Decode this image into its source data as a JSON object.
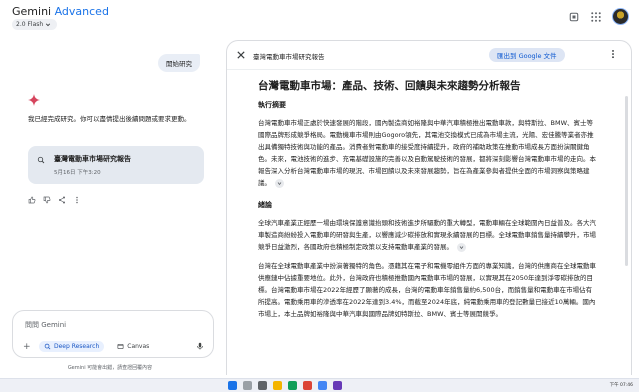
{
  "header": {
    "brand_gemini": "Gemini",
    "brand_advanced": "Advanced",
    "model": "2.0 Flash"
  },
  "chat": {
    "user_message": "開始研究",
    "reply": "我已經完成研究。你可以盡情提出後續問題或要求更動。",
    "report_card": {
      "title": "臺灣電動車市場研究報告",
      "date": "5月16日 下午3:20"
    },
    "input_placeholder": "問問 Gemini",
    "tools": {
      "deep_research": "Deep Research",
      "canvas": "Canvas"
    },
    "disclaimer": "Gemini 可能會出錯，請查證回覆內容"
  },
  "doc": {
    "header_title": "臺灣電動車市場研究報告",
    "export_label": "匯出到 Google 文件",
    "title": "台灣電動車市場：產品、技術、回饋與未來趨勢分析報告",
    "sections": [
      {
        "heading": "執行摘要",
        "paragraphs": [
          "台灣電動車市場正處於快速發展的階段，國內製造商如裕隆與中華汽車積極推出電動車款，與特斯拉、BMW、賓士等國際品牌形成競爭格局。電動機車市場則由Gogoro領先，其電池交換模式已成為市場主流，光陽、宏佳騰等業者亦推出具備獨特技術與功能的產品。消費者對電動車的接受度持續提升，政府的補助政策在推動市場成長方面扮演關鍵角色。未來，電池技術的進步、充電基礎設施的完善以及自動駕駛技術的發展，都將深刻影響台灣電動車市場的走向。本報告深入分析台灣電動車市場的現況、市場回饋以及未來發展趨勢，旨在為產業參與者提供全面的市場洞察與策略建議。"
        ]
      },
      {
        "heading": "緒論",
        "paragraphs": [
          "全球汽車產業正經歷一場由環境保護意識抬頭和技術進步所驅動的重大轉型，電動車輛在全球範圍內日益普及。各大汽車製造商紛紛投入電動車的研發與生產，以響應減少碳排放和實現永續發展的目標。全球電動車銷售量持續攀升，市場競爭日益激烈，各國政府也積極制定政策以支持電動車產業的發展。",
          "台灣在全球電動車產業中扮演著獨特的角色。憑藉其在電子和電機零組件方面的專業知識，台灣的供應商在全球電動車供應鏈中佔據重要地位。此外，台灣政府也積極推動國內電動車市場的發展，以實現其在2050年達到淨零碳排放的目標。台灣電動車市場在2022年經歷了顯著的成長，台灣的電動車年銷售量約6,500台，而銷售量和電動車在市場佔有所提高。電動乘用車的滲透率在2022年達到3.4%，而截至2024年底，純電動乘用車的登記數量已接近10萬輛。國內市場上，本土品牌如裕隆與中華汽車與國際品牌如特斯拉、BMW、賓士等展開競爭。"
        ]
      }
    ]
  },
  "taskbar": {
    "time": "下午 07:46"
  }
}
